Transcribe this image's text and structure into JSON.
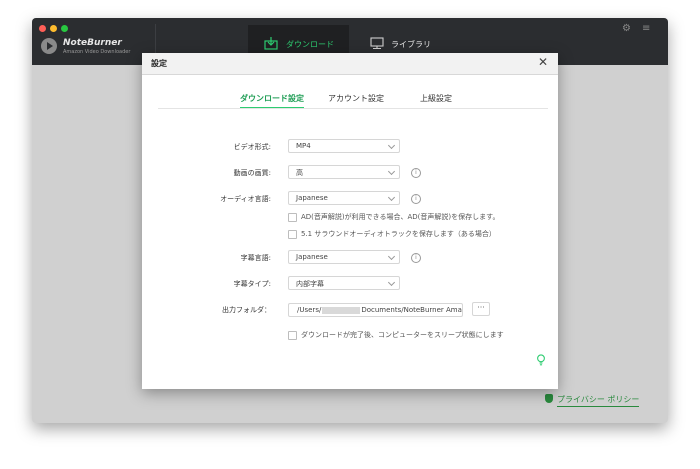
{
  "colors": {
    "accent": "#2ecc71",
    "titlebar": "#2b2d30",
    "traffic": [
      "#ff5f57",
      "#febc2e",
      "#28c840"
    ]
  },
  "app": {
    "brand_name": "NoteBurner",
    "brand_sub": "Amazon Video Downloader",
    "tab_download": "ダウンロード",
    "tab_library": "ライブラリ",
    "settings_icon": "gear-icon",
    "menu_icon": "menu-icon",
    "privacy_link": "プライバシー ポリシー"
  },
  "dialog": {
    "title": "設定",
    "close_glyph": "✕",
    "tabs": [
      "ダウンロード設定",
      "アカウント設定",
      "上級設定"
    ],
    "active_tab": 0,
    "video_format": {
      "label": "ビデオ形式:",
      "value": "MP4"
    },
    "video_quality": {
      "label": "動画の画質:",
      "value": "高"
    },
    "audio_language": {
      "label": "オーディオ言語:",
      "value": "Japanese"
    },
    "ad_option": "AD(音声解説)が利用できる場合、AD(音声解説)を保存します。",
    "surround_option": "5.1 サラウンドオーディオトラックを保存します（ある場合）",
    "subtitle_language": {
      "label": "字幕言語:",
      "value": "Japanese"
    },
    "subtitle_type": {
      "label": "字幕タイプ:",
      "value": "内部字幕"
    },
    "output_folder": {
      "label": "出力フォルダ：",
      "path_prefix": "/Users/",
      "path_suffix": "Documents/NoteBurner Amaz",
      "browse": "···"
    },
    "sleep_option": "ダウンロードが完了後、コンピューターをスリープ状態にします"
  }
}
